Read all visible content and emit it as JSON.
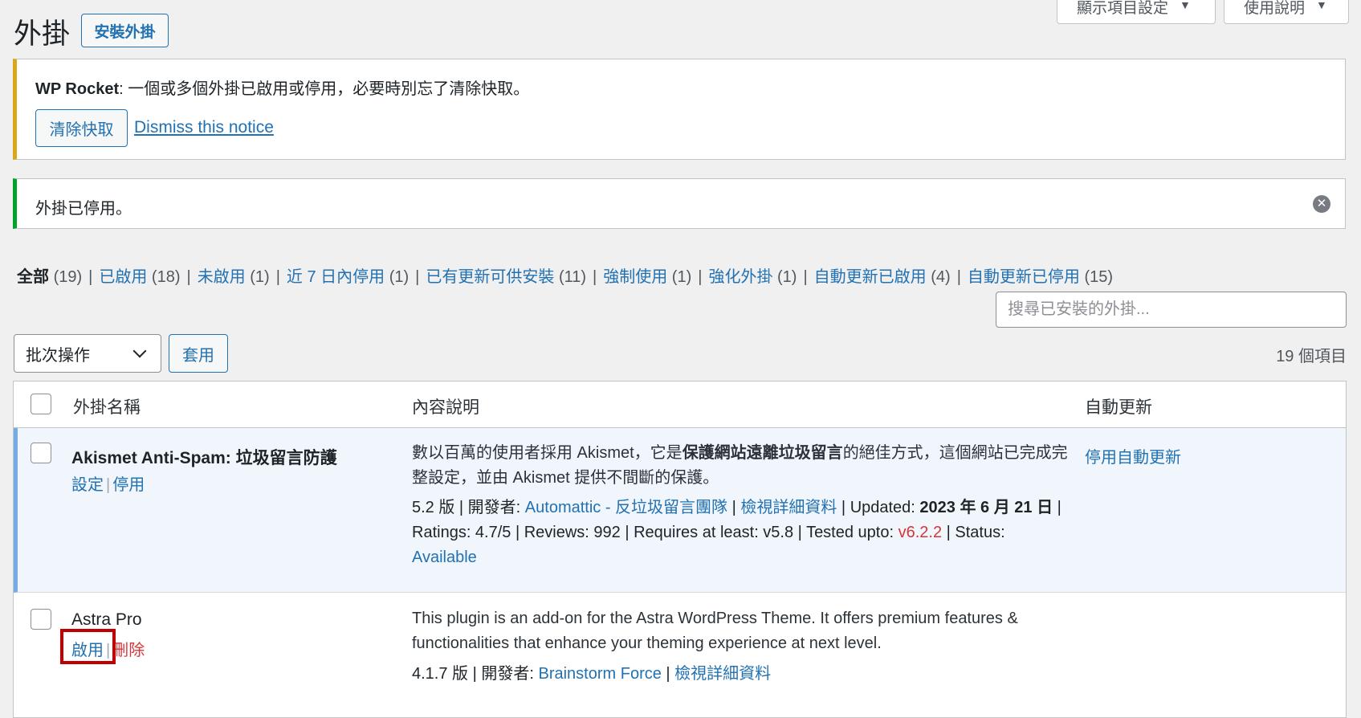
{
  "screen_tabs": {
    "screen_options": "顯示項目設定",
    "help": "使用說明"
  },
  "header": {
    "title": "外掛",
    "add_new": "安裝外掛"
  },
  "notices": {
    "rocket": {
      "brand": "WP Rocket",
      "message": ": 一個或多個外掛已啟用或停用，必要時別忘了清除快取。",
      "clear_cache": "清除快取",
      "dismiss": "Dismiss this notice"
    },
    "deactivated": {
      "message": "外掛已停用。"
    }
  },
  "filters": [
    {
      "label": "全部",
      "count": "(19)",
      "current": true
    },
    {
      "label": "已啟用",
      "count": "(18)"
    },
    {
      "label": "未啟用",
      "count": "(1)"
    },
    {
      "label": "近 7 日內停用",
      "count": "(1)"
    },
    {
      "label": "已有更新可供安裝",
      "count": "(11)"
    },
    {
      "label": "強制使用",
      "count": "(1)"
    },
    {
      "label": "強化外掛",
      "count": "(1)"
    },
    {
      "label": "自動更新已啟用",
      "count": "(4)"
    },
    {
      "label": "自動更新已停用",
      "count": "(15)"
    }
  ],
  "search": {
    "placeholder": "搜尋已安裝的外掛..."
  },
  "bulk": {
    "selected": "批次操作",
    "apply": "套用"
  },
  "items_count": "19 個項目",
  "table": {
    "columns": {
      "name": "外掛名稱",
      "description": "內容說明",
      "auto_update": "自動更新"
    },
    "rows": [
      {
        "name": "Akismet Anti-Spam: 垃圾留言防護",
        "actions": {
          "settings": "設定",
          "deactivate": "停用"
        },
        "desc_pre": "數以百萬的使用者採用 Akismet，它是",
        "desc_bold": "保護網站遠離垃圾留言",
        "desc_post": "的絕佳方式，這個網站已完成完整設定，並由 Akismet 提供不間斷的保護。",
        "version": "5.2 版",
        "dev_label": "開發者:",
        "author": "Automattic - 反垃圾留言團隊",
        "details": "檢視詳細資料",
        "updated_label": "Updated:",
        "updated": "2023 年 6 月 21 日",
        "ratings": "Ratings: 4.7/5",
        "reviews": "Reviews: 992",
        "requires": "Requires at least: v5.8",
        "tested_label": "Tested upto:",
        "tested": "v6.2.2",
        "status_label": "Status:",
        "status": "Available",
        "auto_update": "停用自動更新"
      },
      {
        "name": "Astra Pro",
        "actions": {
          "activate": "啟用",
          "delete": "刪除"
        },
        "desc": "This plugin is an add-on for the Astra WordPress Theme. It offers premium features & functionalities that enhance your theming experience at next level.",
        "version": "4.1.7 版",
        "dev_label": "開發者:",
        "author": "Brainstorm Force",
        "details": "檢視詳細資料"
      }
    ]
  },
  "colors": {
    "link": "#2271b1",
    "warning_border": "#dba617",
    "success_border": "#00a32a",
    "active_row": "#f0f6fc",
    "active_border": "#72aee6",
    "delete": "#d63638",
    "highlight": "#c00000"
  }
}
